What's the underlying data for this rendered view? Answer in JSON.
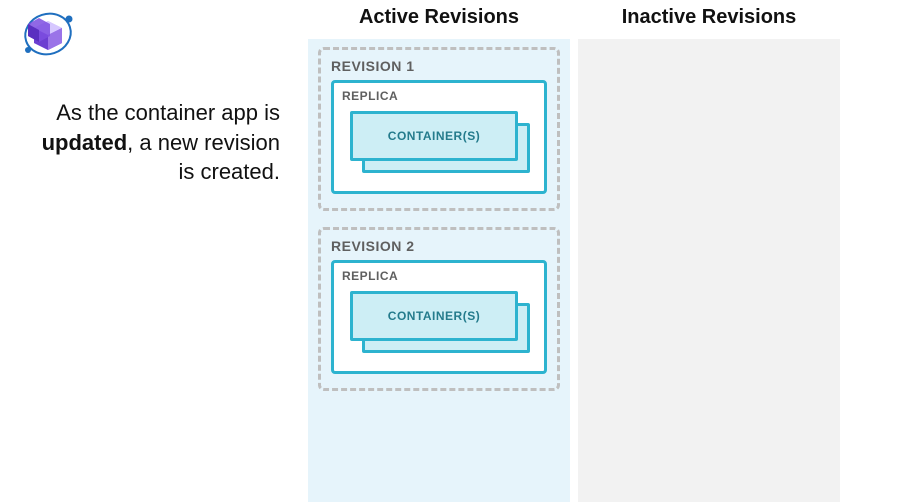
{
  "explainer": {
    "prefix": "As the container app is ",
    "bold": "updated",
    "suffix": ", a new revision is created."
  },
  "columns": {
    "active": {
      "title": "Active Revisions",
      "revisions": [
        {
          "name": "REVISION 1",
          "replica_label": "REPLICA",
          "container_label": "CONTAINER(S)"
        },
        {
          "name": "REVISION 2",
          "replica_label": "REPLICA",
          "container_label": "CONTAINER(S)"
        }
      ]
    },
    "inactive": {
      "title": "Inactive Revisions",
      "revisions": []
    }
  },
  "icon": {
    "name": "azure-container-apps-icon"
  },
  "colors": {
    "active_bg": "#e6f4fb",
    "inactive_bg": "#f2f2f2",
    "outline": "#2db3cf",
    "container_fill": "#cdeef5",
    "dashed": "#bfbfbf"
  }
}
